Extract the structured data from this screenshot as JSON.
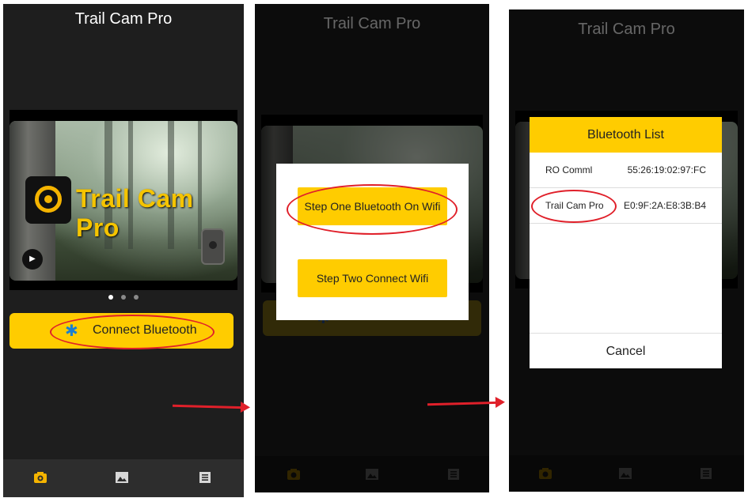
{
  "app_title": "Trail Cam Pro",
  "banner": {
    "logo_text": "Trail Cam Pro"
  },
  "carousel": {
    "page_count": 3,
    "active_index": 0
  },
  "connect_button": {
    "label": "Connect Bluetooth",
    "icon": "bluetooth-icon"
  },
  "wifi_dialog": {
    "step_one_label": "Step One Bluetooth On Wifi",
    "step_two_label": "Step Two Connect Wifi"
  },
  "bluetooth_list": {
    "title": "Bluetooth List",
    "devices": [
      {
        "name": "RO Comml",
        "mac": "55:26:19:02:97:FC"
      },
      {
        "name": "Trail Cam Pro",
        "mac": "E0:9F:2A:E8:3B:B4"
      }
    ],
    "cancel_label": "Cancel"
  },
  "tab_bar": {
    "icons": [
      "camera-icon",
      "gallery-icon",
      "list-icon"
    ],
    "active_index": 0
  },
  "colors": {
    "accent": "#ffcc00",
    "background": "#1e1e1e",
    "annotation": "#e0202a",
    "bluetooth": "#1a7fd0"
  }
}
